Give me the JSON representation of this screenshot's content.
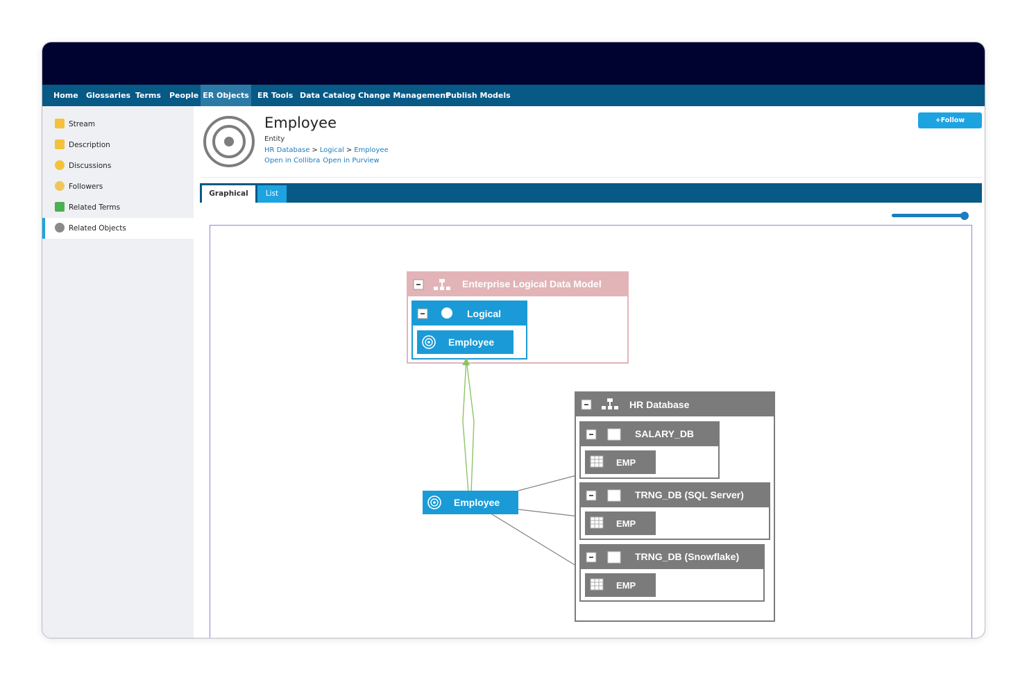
{
  "nav": {
    "items": [
      "Home",
      "Glossaries",
      "Terms",
      "People",
      "ER Objects",
      "ER Tools",
      "Data Catalog",
      "Change Management",
      "Publish Models"
    ],
    "active": "ER Objects"
  },
  "sidebar": {
    "items": [
      {
        "label": "Stream",
        "icon": "stream-icon"
      },
      {
        "label": "Description",
        "icon": "description-icon"
      },
      {
        "label": "Discussions",
        "icon": "discussions-icon"
      },
      {
        "label": "Followers",
        "icon": "followers-icon"
      },
      {
        "label": "Related Terms",
        "icon": "related-terms-icon"
      },
      {
        "label": "Related Objects",
        "icon": "related-objects-icon"
      }
    ],
    "active": "Related Objects"
  },
  "entity": {
    "title": "Employee",
    "type": "Entity",
    "breadcrumb": [
      "HR Database",
      "Logical",
      "Employee"
    ],
    "breadcrumb_sep": ">",
    "links": [
      "Open in Collibra",
      "Open in Purview"
    ],
    "icon": "target-icon"
  },
  "follow_label": "+Follow",
  "tabs": [
    "Graphical",
    "List"
  ],
  "active_tab": "Graphical",
  "diagram": {
    "enterprise_model": {
      "label": "Enterprise Logical Data Model",
      "color": "#e2b4b8"
    },
    "logical": {
      "label": "Logical",
      "color": "#1a9bd7"
    },
    "employee_inner": {
      "label": "Employee"
    },
    "employee_node": {
      "label": "Employee",
      "color": "#1a9bd7"
    },
    "hr_database": {
      "label": "HR Database",
      "color": "#7b7b7b"
    },
    "salary_db": {
      "label": "SALARY_DB",
      "table": "EMP"
    },
    "trng_sql": {
      "label": "TRNG_DB (SQL Server)",
      "table": "EMP"
    },
    "trng_snow": {
      "label": "TRNG_DB (Snowflake)",
      "table": "EMP"
    },
    "link_colors": {
      "lineage": "#8cc464",
      "relation": "#808080"
    }
  },
  "colors": {
    "topbar": "#00032f",
    "navbar": "#075986",
    "accent": "#1ea3e1"
  }
}
